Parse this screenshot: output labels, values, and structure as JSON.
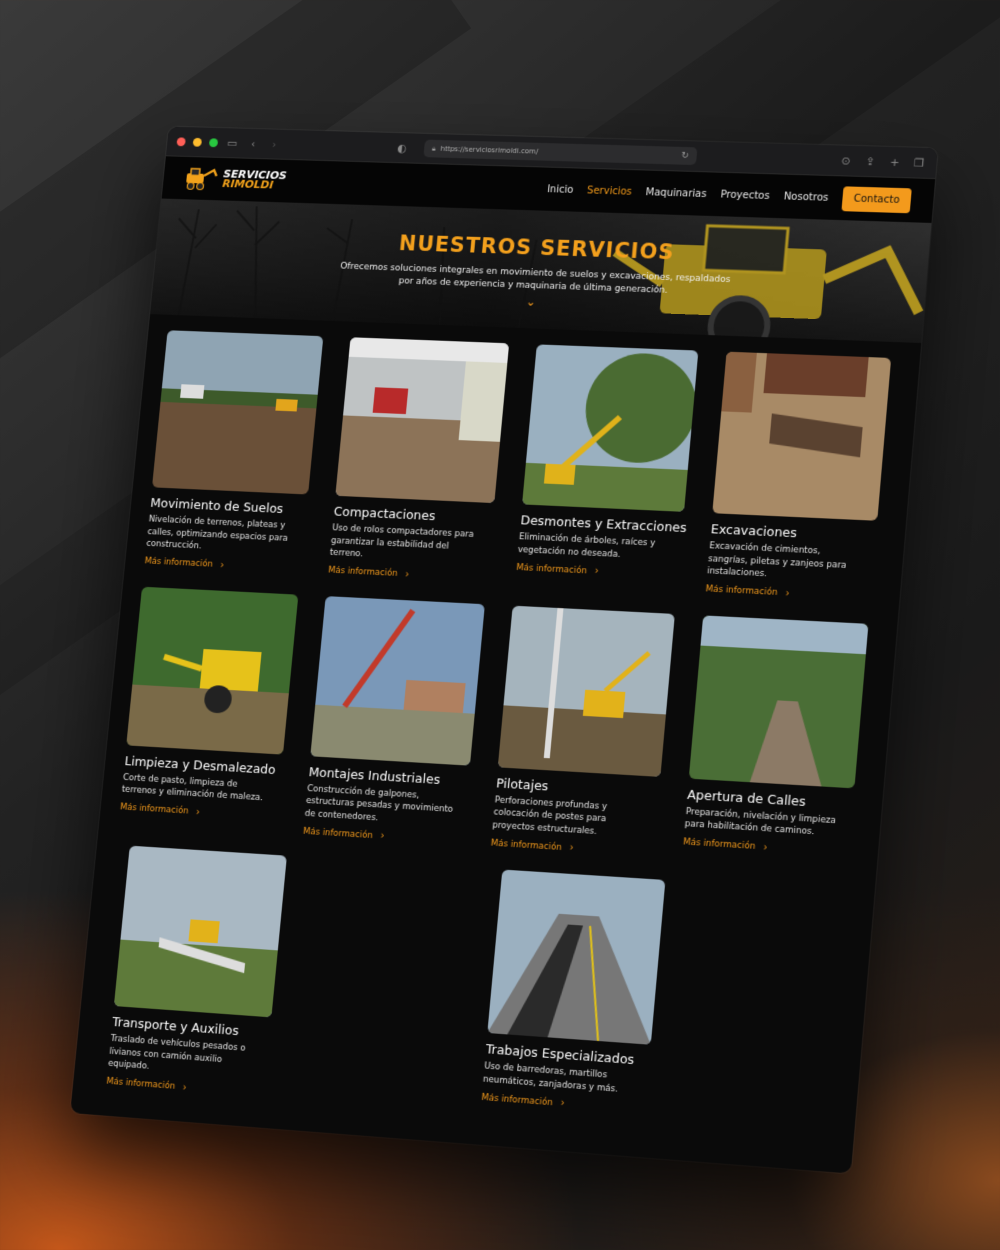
{
  "browser": {
    "url": "https://serviciosrimoldi.com/"
  },
  "nav": {
    "logo_line1": "SERVICIOS",
    "logo_line2": "RIMOLDI",
    "items": [
      "Inicio",
      "Servicios",
      "Maquinarias",
      "Proyectos",
      "Nosotros"
    ],
    "active": "Servicios",
    "cta": "Contacto"
  },
  "hero": {
    "title": "NUESTROS SERVICIOS",
    "subtitle": "Ofrecemos soluciones integrales en movimiento de suelos y excavaciones, respaldados por años de experiencia y maquinaria de última generación."
  },
  "services": [
    {
      "title": "Movimiento de Suelos",
      "desc": "Nivelación de terrenos, plateas y calles, optimizando espacios para construcción.",
      "link": "Más información"
    },
    {
      "title": "Compactaciones",
      "desc": "Uso de rolos compactadores para garantizar la estabilidad del terreno.",
      "link": "Más información"
    },
    {
      "title": "Desmontes y Extracciones",
      "desc": "Eliminación de árboles, raíces y vegetación no deseada.",
      "link": "Más información"
    },
    {
      "title": "Excavaciones",
      "desc": "Excavación de cimientos, sangrías, piletas y zanjeos para instalaciones.",
      "link": "Más información"
    },
    {
      "title": "Limpieza y Desmalezado",
      "desc": "Corte de pasto, limpieza de terrenos y eliminación de maleza.",
      "link": "Más información"
    },
    {
      "title": "Montajes Industriales",
      "desc": "Construcción de galpones, estructuras pesadas y movimiento de contenedores.",
      "link": "Más información"
    },
    {
      "title": "Pilotajes",
      "desc": "Perforaciones profundas y colocación de postes para proyectos estructurales.",
      "link": "Más información"
    },
    {
      "title": "Apertura de Calles",
      "desc": "Preparación, nivelación y limpieza para habilitación de caminos.",
      "link": "Más información"
    },
    {
      "title": "Transporte y Auxilios",
      "desc": "Traslado de vehículos pesados o livianos con camión auxilio equipado.",
      "link": "Más información"
    },
    {
      "title": "Trabajos Especializados",
      "desc": "Uso de barredoras, martillos neumáticos, zanjadoras y más.",
      "link": "Más información"
    }
  ],
  "colors": {
    "accent": "#f39a1c",
    "page_bg": "#0a0a0a"
  },
  "icons": [
    "sidebar-icon",
    "back-icon",
    "forward-icon",
    "shield-icon",
    "lock-icon",
    "reload-icon",
    "download-icon",
    "share-icon",
    "plus-icon",
    "tabs-icon",
    "chevron-down-icon",
    "chevron-right-icon"
  ]
}
